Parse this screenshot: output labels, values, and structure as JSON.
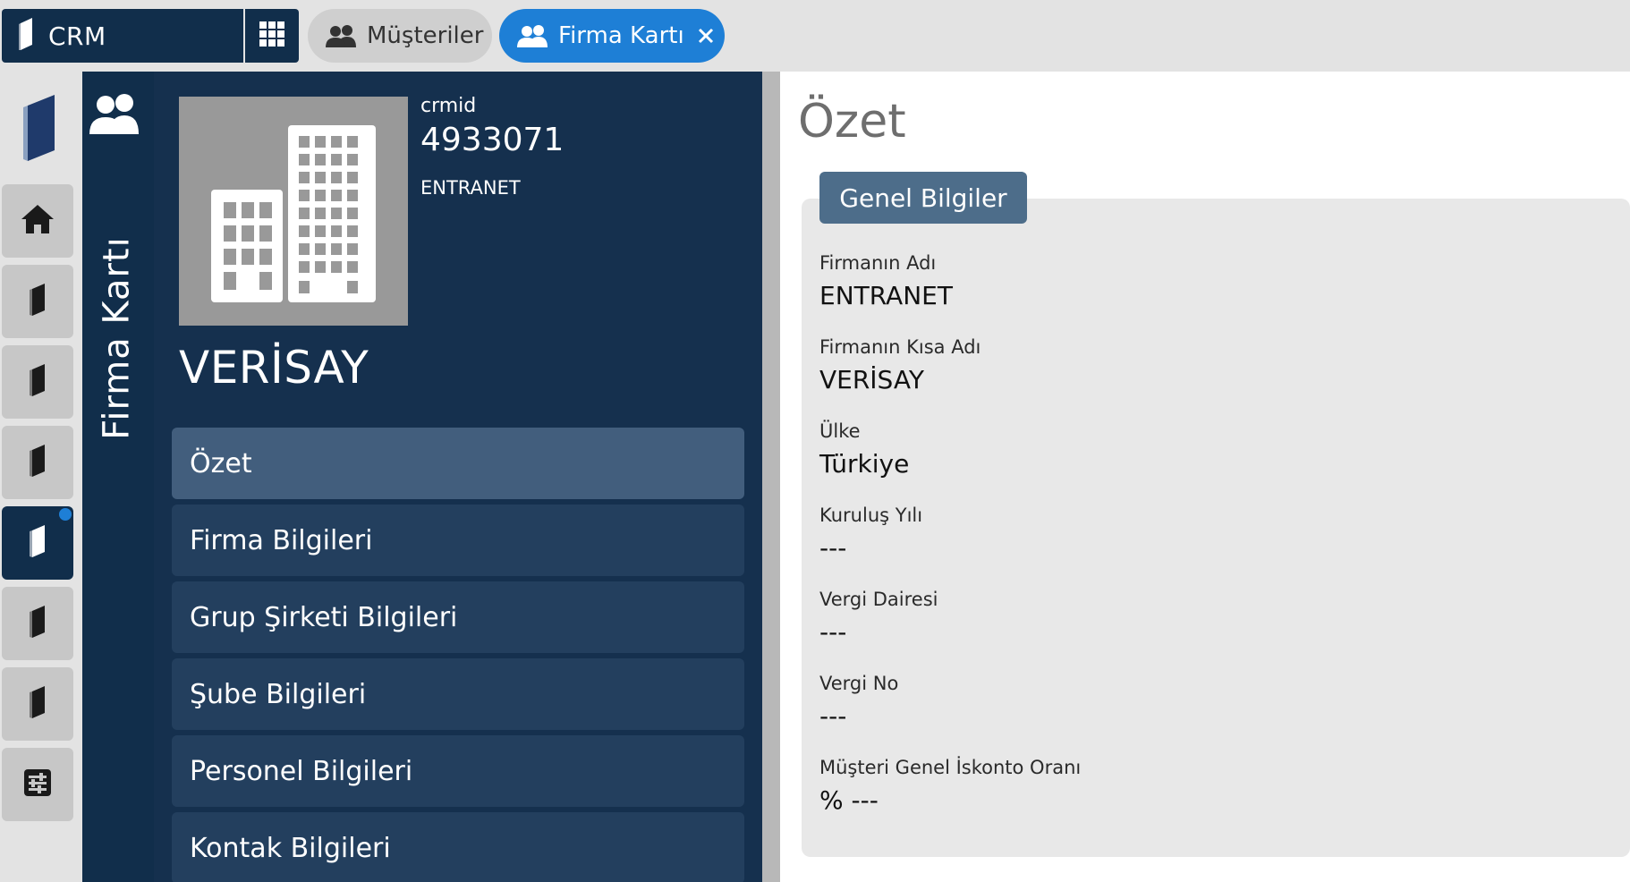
{
  "topbar": {
    "app_name": "CRM",
    "tabs": [
      {
        "label": "Müşteriler",
        "active": false
      },
      {
        "label": "Firma Kartı",
        "active": true,
        "closable": true
      }
    ]
  },
  "rail": {
    "items": [
      {
        "icon": "home-icon"
      },
      {
        "icon": "book-icon"
      },
      {
        "icon": "book-icon"
      },
      {
        "icon": "book-icon"
      },
      {
        "icon": "book-icon",
        "active": true,
        "notification": true
      },
      {
        "icon": "book-icon"
      },
      {
        "icon": "book-icon"
      },
      {
        "icon": "settings-sliders-icon"
      }
    ]
  },
  "vstrip": {
    "title": "Firma Kartı",
    "icon": "users-icon"
  },
  "nav": {
    "crmid_label": "crmid",
    "crmid_value": "4933071",
    "firm_name": "ENTRANET",
    "short_name": "VERİSAY",
    "menu": [
      {
        "label": "Özet",
        "active": true
      },
      {
        "label": "Firma Bilgileri"
      },
      {
        "label": "Grup Şirketi Bilgileri"
      },
      {
        "label": "Şube Bilgileri"
      },
      {
        "label": "Personel Bilgileri"
      },
      {
        "label": "Kontak Bilgileri"
      }
    ]
  },
  "content": {
    "title": "Özet",
    "section_tab": "Genel Bilgiler",
    "fields": [
      {
        "label": "Firmanın Adı",
        "value": "ENTRANET"
      },
      {
        "label": "Firmanın Kısa Adı",
        "value": "VERİSAY"
      },
      {
        "label": "Ülke",
        "value": "Türkiye"
      },
      {
        "label": "Kuruluş Yılı",
        "value": "---"
      },
      {
        "label": "Vergi Dairesi",
        "value": "---"
      },
      {
        "label": "Vergi No",
        "value": "---"
      },
      {
        "label": "Müşteri Genel İskonto Oranı",
        "value": "% ---"
      }
    ]
  },
  "colors": {
    "navy": "#112e4b",
    "panel": "#15304e",
    "menu_item": "#233f5e",
    "menu_active": "#425e7d",
    "accent_blue": "#1e7fd6",
    "section_tab": "#4d6d8a"
  }
}
